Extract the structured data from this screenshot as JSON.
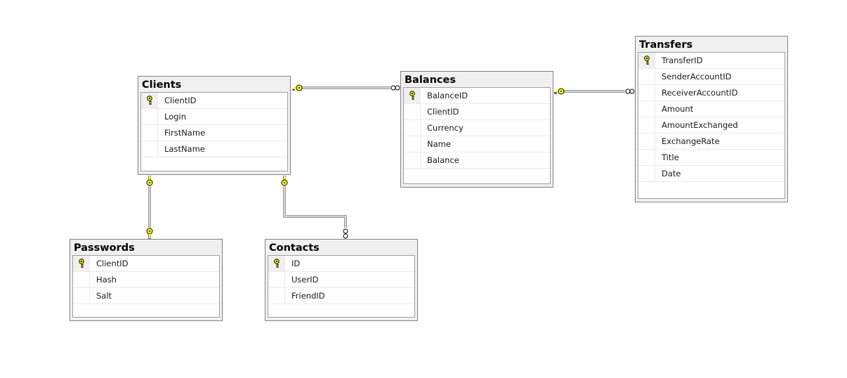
{
  "diagram": {
    "tables": [
      {
        "id": "clients",
        "name": "Clients",
        "columns": [
          {
            "name": "ClientID",
            "pk": true
          },
          {
            "name": "Login",
            "pk": false
          },
          {
            "name": "FirstName",
            "pk": false
          },
          {
            "name": "LastName",
            "pk": false
          }
        ]
      },
      {
        "id": "balances",
        "name": "Balances",
        "columns": [
          {
            "name": "BalanceID",
            "pk": true
          },
          {
            "name": "ClientID",
            "pk": false
          },
          {
            "name": "Currency",
            "pk": false
          },
          {
            "name": "Name",
            "pk": false
          },
          {
            "name": "Balance",
            "pk": false
          }
        ]
      },
      {
        "id": "transfers",
        "name": "Transfers",
        "columns": [
          {
            "name": "TransferID",
            "pk": true
          },
          {
            "name": "SenderAccountID",
            "pk": false
          },
          {
            "name": "ReceiverAccountID",
            "pk": false
          },
          {
            "name": "Amount",
            "pk": false
          },
          {
            "name": "AmountExchanged",
            "pk": false
          },
          {
            "name": "ExchangeRate",
            "pk": false
          },
          {
            "name": "Title",
            "pk": false
          },
          {
            "name": "Date",
            "pk": false
          }
        ]
      },
      {
        "id": "passwords",
        "name": "Passwords",
        "columns": [
          {
            "name": "ClientID",
            "pk": true
          },
          {
            "name": "Hash",
            "pk": false
          },
          {
            "name": "Salt",
            "pk": false
          }
        ]
      },
      {
        "id": "contacts",
        "name": "Contacts",
        "columns": [
          {
            "name": "ID",
            "pk": true
          },
          {
            "name": "UserID",
            "pk": false
          },
          {
            "name": "FriendID",
            "pk": false
          }
        ]
      }
    ],
    "relationships": [
      {
        "from": "Clients",
        "to": "Balances",
        "from_end": "one (key)",
        "to_end": "many (infinity)"
      },
      {
        "from": "Balances",
        "to": "Transfers",
        "from_end": "one (key)",
        "to_end": "many (infinity)"
      },
      {
        "from": "Clients",
        "to": "Passwords",
        "from_end": "one (key)",
        "to_end": "one (key)"
      },
      {
        "from": "Clients",
        "to": "Contacts",
        "from_end": "one (key)",
        "to_end": "many (infinity)"
      }
    ],
    "colors": {
      "key_fill": "#ffff00",
      "line": "#808080",
      "header_bg": "#f0f0f0",
      "border": "#828282"
    },
    "icons": {
      "primary_key": "key-icon",
      "one_end": "key-icon",
      "many_end": "infinity-icon"
    }
  }
}
